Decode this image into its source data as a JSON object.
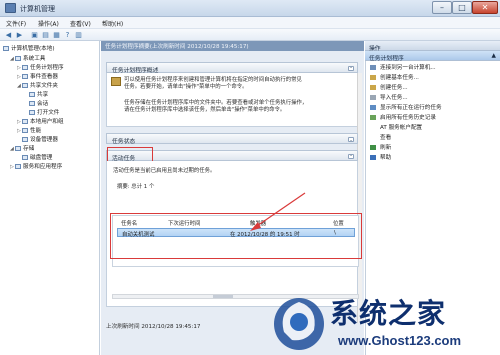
{
  "window": {
    "title": "计算机管理"
  },
  "menubar": [
    "文件(F)",
    "操作(A)",
    "查看(V)",
    "帮助(H)"
  ],
  "tree": {
    "root": "计算机管理(本地)",
    "items": [
      {
        "label": "系统工具",
        "level": 1,
        "toggle": "◢"
      },
      {
        "label": "任务计划程序",
        "level": 2,
        "toggle": "▷"
      },
      {
        "label": "事件查看器",
        "level": 2,
        "toggle": "▷"
      },
      {
        "label": "共享文件夹",
        "level": 2,
        "toggle": "◢"
      },
      {
        "label": "共享",
        "level": 3,
        "toggle": ""
      },
      {
        "label": "会话",
        "level": 3,
        "toggle": ""
      },
      {
        "label": "打开文件",
        "level": 3,
        "toggle": ""
      },
      {
        "label": "本地用户和组",
        "level": 2,
        "toggle": "▷"
      },
      {
        "label": "性能",
        "level": 2,
        "toggle": "▷"
      },
      {
        "label": "设备管理器",
        "level": 2,
        "toggle": ""
      },
      {
        "label": "存储",
        "level": 1,
        "toggle": "◢"
      },
      {
        "label": "磁盘管理",
        "level": 2,
        "toggle": ""
      },
      {
        "label": "服务和应用程序",
        "level": 1,
        "toggle": "▷"
      }
    ]
  },
  "center": {
    "breadcrumb": "任务计划程序摘要(上次刷新时间 2012/10/28 19:45:17)",
    "overview": {
      "title": "任务计划程序概述",
      "para1": [
        "可以使用任务计划程序来创建和管理计算机将在指定的时间自动执行的常见",
        "任务。若要开始，请单击\"操作\"菜单中的一个命令。"
      ],
      "para2": [
        "任务存储在任务计划程序库中的文件夹中。若要查看或对单个任务执行操作，",
        "请在任务计划程序库中选择该任务，然后单击\"操作\"菜单中的命令。"
      ]
    },
    "status_title": "任务状态",
    "active": {
      "title": "活动任务",
      "desc": "活动任务是当前已启用且尚未过期的任务。",
      "summary": "摘要: 总计 1 个",
      "columns": [
        "任务名",
        "下次运行时间",
        "触发器",
        "位置"
      ],
      "rows": [
        {
          "name": "自动关机测试",
          "next_run": "",
          "trigger": "在 2012/10/28 的 19:51 时",
          "location": "\\"
        }
      ]
    },
    "footer": "上次刷新时间 2012/10/28 19:45:17"
  },
  "actions": {
    "head1": "操作",
    "head2": "任务计划程序",
    "items": [
      {
        "label": "连接到另一台计算机...",
        "icon": "computer-icon",
        "color": "#6f8fb8"
      },
      {
        "label": "创建基本任务...",
        "icon": "new-task-icon",
        "color": "#caa64a"
      },
      {
        "label": "创建任务...",
        "icon": "task-icon",
        "color": "#caa64a"
      },
      {
        "label": "导入任务...",
        "icon": "import-icon",
        "color": "#9aa6b4"
      },
      {
        "label": "显示所有正在运行的任务",
        "icon": "running-tasks-icon",
        "color": "#5e8cc3"
      },
      {
        "label": "启用所有任务历史记录",
        "icon": "history-icon",
        "color": "#6aa35a"
      },
      {
        "label": "AT 服务帐户配置",
        "icon": "",
        "color": ""
      },
      {
        "label": "查看",
        "icon": "",
        "color": ""
      },
      {
        "label": "刷新",
        "icon": "refresh-icon",
        "color": "#3f8f45"
      },
      {
        "label": "帮助",
        "icon": "help-icon",
        "color": "#3b6fb8"
      }
    ]
  },
  "colors": {
    "annotation": "#d93a3a",
    "accent": "#7d97b8"
  }
}
